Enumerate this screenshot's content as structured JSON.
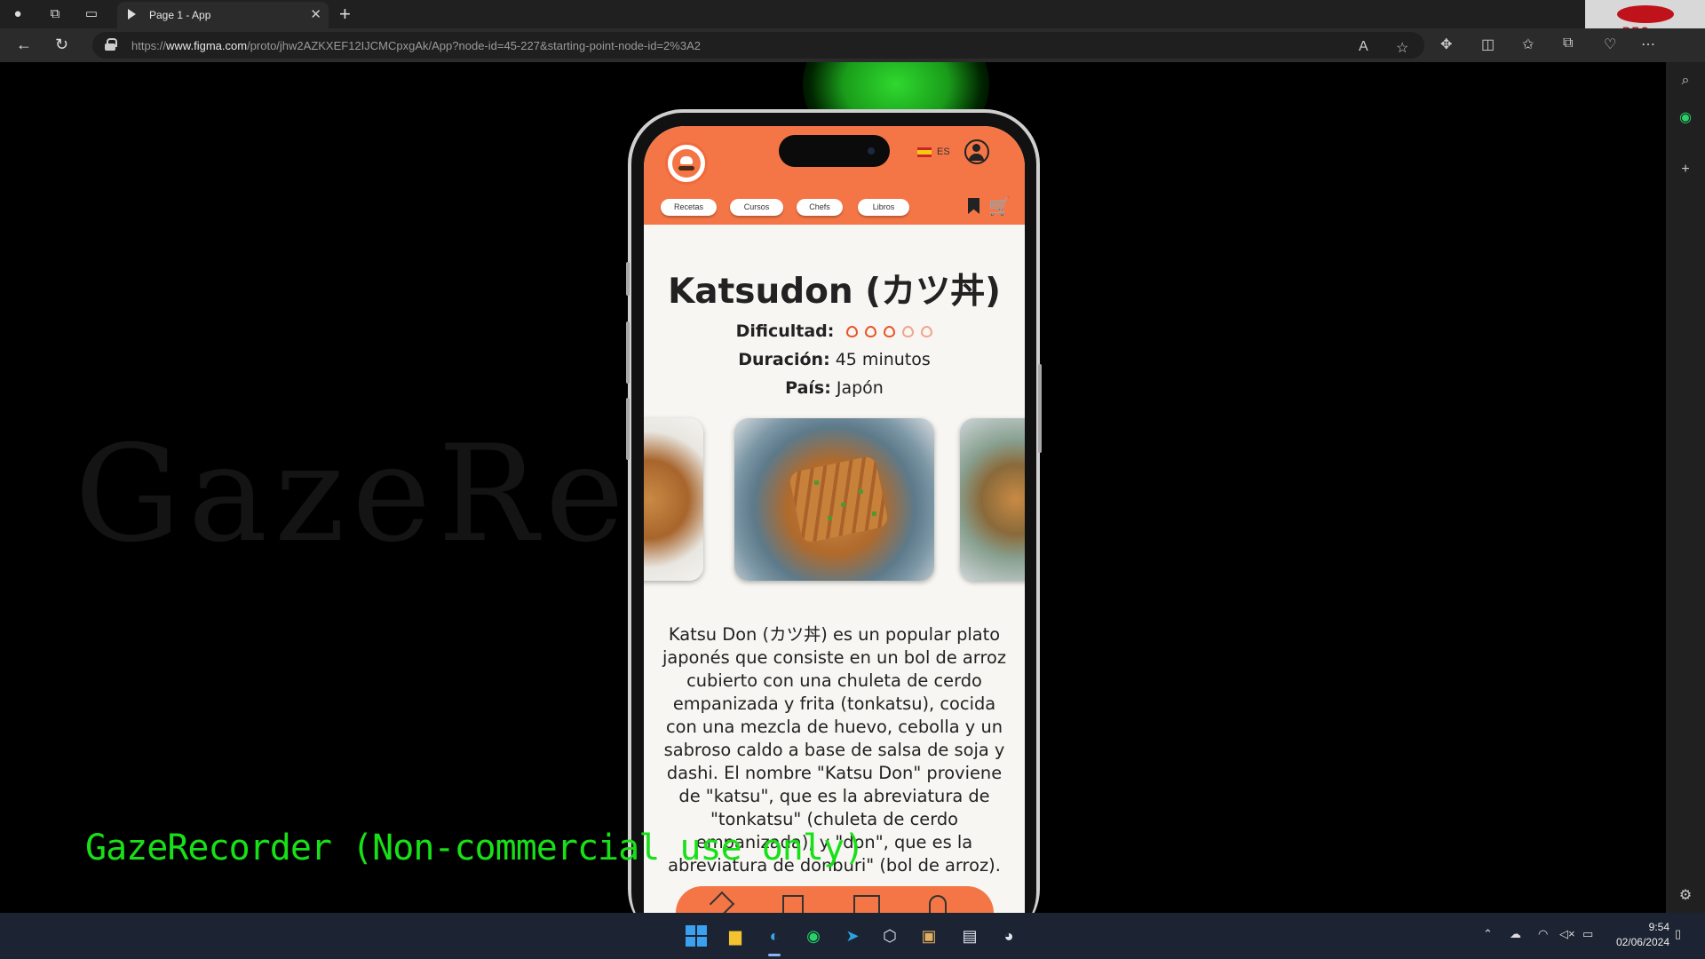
{
  "browser": {
    "tab_title": "Page 1 - App",
    "url_host": "www.figma.com",
    "url_prefix": "https://",
    "url_rest": "/proto/jhw2AZKXEF12IJCMCpxgAk/App?node-id=45-227&starting-point-node-id=2%3A2",
    "recorder_badge": "REC"
  },
  "app": {
    "language": "ES",
    "nav": [
      "Recetas",
      "Cursos",
      "Chefs",
      "Libros"
    ],
    "brand_color": "#f47646"
  },
  "recipe": {
    "title": "Katsudon (カツ丼)",
    "difficulty_label": "Dificultad:",
    "difficulty_level": 3,
    "difficulty_max": 5,
    "duration_label": "Duración:",
    "duration_value": "45 minutos",
    "country_label": "País:",
    "country_value": "Japón",
    "description": "Katsu Don (カツ丼) es un popular plato japonés que consiste en un bol de arroz cubierto con una chuleta de cerdo empanizada y frita (tonkatsu), cocida con una mezcla de huevo, cebolla y un sabroso caldo a base de salsa de soja y dashi. El nombre \"Katsu Don\" proviene de \"katsu\", que es la abreviatura de \"tonkatsu\" (chuleta de cerdo empanizada), y \"don\", que es la abreviatura de donburi\" (bol de arroz)."
  },
  "overlay": {
    "watermark_big": "GazeRec",
    "gaze_label": "GazeRecorder (Non-commercial use only)"
  },
  "taskbar": {
    "time": "9:54",
    "date": "02/06/2024"
  }
}
